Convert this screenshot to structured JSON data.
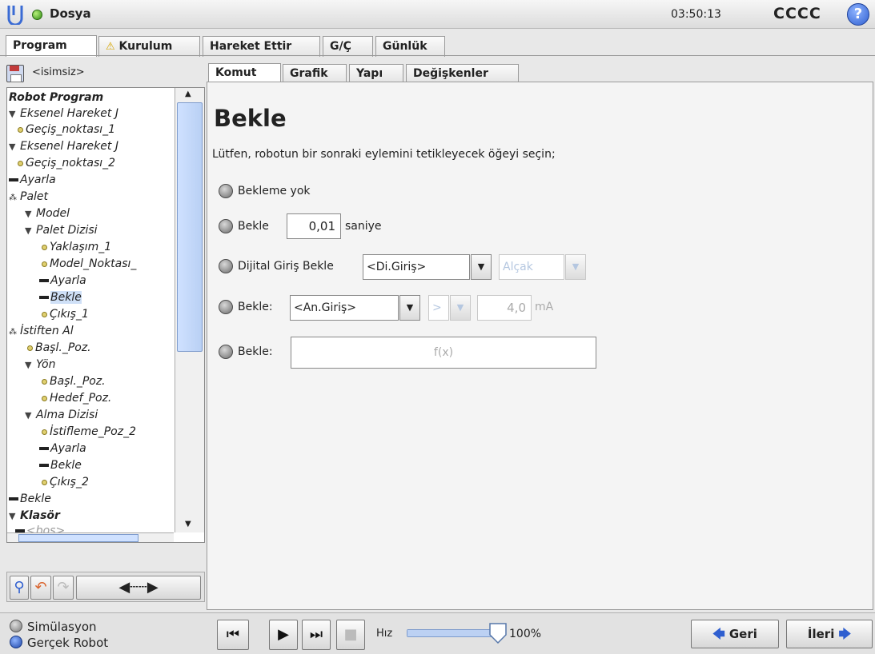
{
  "titlebar": {
    "menu": "Dosya",
    "time": "03:50:13",
    "robot_name": "CCCC",
    "help": "?"
  },
  "main_tabs": [
    {
      "label": "Program",
      "active": true
    },
    {
      "label": "Kurulum",
      "warning": true
    },
    {
      "label": "Hareket Ettir"
    },
    {
      "label": "G/Ç"
    },
    {
      "label": "Günlük"
    }
  ],
  "left": {
    "filename": "<isimsiz>",
    "tree": [
      {
        "label": "Robot Program"
      },
      {
        "label": "Eksenel Hareket J"
      },
      {
        "label": "Geçiş_noktası_1"
      },
      {
        "label": "Eksenel Hareket J"
      },
      {
        "label": "Geçiş_noktası_2"
      },
      {
        "label": "Ayarla"
      },
      {
        "label": "Palet"
      },
      {
        "label": "Model"
      },
      {
        "label": "Palet Dizisi"
      },
      {
        "label": "Yaklaşım_1"
      },
      {
        "label": "Model_Noktası_"
      },
      {
        "label": "Ayarla"
      },
      {
        "label": "Bekle"
      },
      {
        "label": "Çıkış_1"
      },
      {
        "label": "İstiften Al"
      },
      {
        "label": "Başl._Poz."
      },
      {
        "label": "Yön"
      },
      {
        "label": "Başl._Poz."
      },
      {
        "label": "Hedef_Poz."
      },
      {
        "label": "Alma Dizisi"
      },
      {
        "label": "İstifleme_Poz_2"
      },
      {
        "label": "Ayarla"
      },
      {
        "label": "Bekle"
      },
      {
        "label": "Çıkış_2"
      },
      {
        "label": "Bekle"
      },
      {
        "label": "Klasör"
      },
      {
        "label": "<boş>"
      }
    ]
  },
  "content_tabs": [
    {
      "label": "Komut",
      "active": true
    },
    {
      "label": "Grafik"
    },
    {
      "label": "Yapı"
    },
    {
      "label": "Değişkenler"
    }
  ],
  "content": {
    "title": "Bekle",
    "instruction": "Lütfen, robotun bir sonraki eylemini tetikleyecek öğeyi seçin;",
    "opt_none": "Bekleme yok",
    "opt_time": "Bekle",
    "time_value": "0,01",
    "time_unit": "saniye",
    "opt_digital": "Dijital Giriş Bekle",
    "digital_input": "<Di.Giriş>",
    "digital_level": "Alçak",
    "opt_analog": "Bekle:",
    "analog_input": "<An.Giriş>",
    "analog_op": ">",
    "analog_value": "4,0",
    "analog_unit": "mA",
    "opt_expr": "Bekle:",
    "expr": "f(x)"
  },
  "footer": {
    "sim_label": "Simülasyon",
    "real_label": "Gerçek Robot",
    "speed_label": "Hız",
    "speed_value": "100%",
    "speed_fraction": 1.0,
    "back": "Geri",
    "next": "İleri"
  },
  "colors": {
    "accent": "#7d9bcc",
    "selected": "#cfe0f7"
  }
}
